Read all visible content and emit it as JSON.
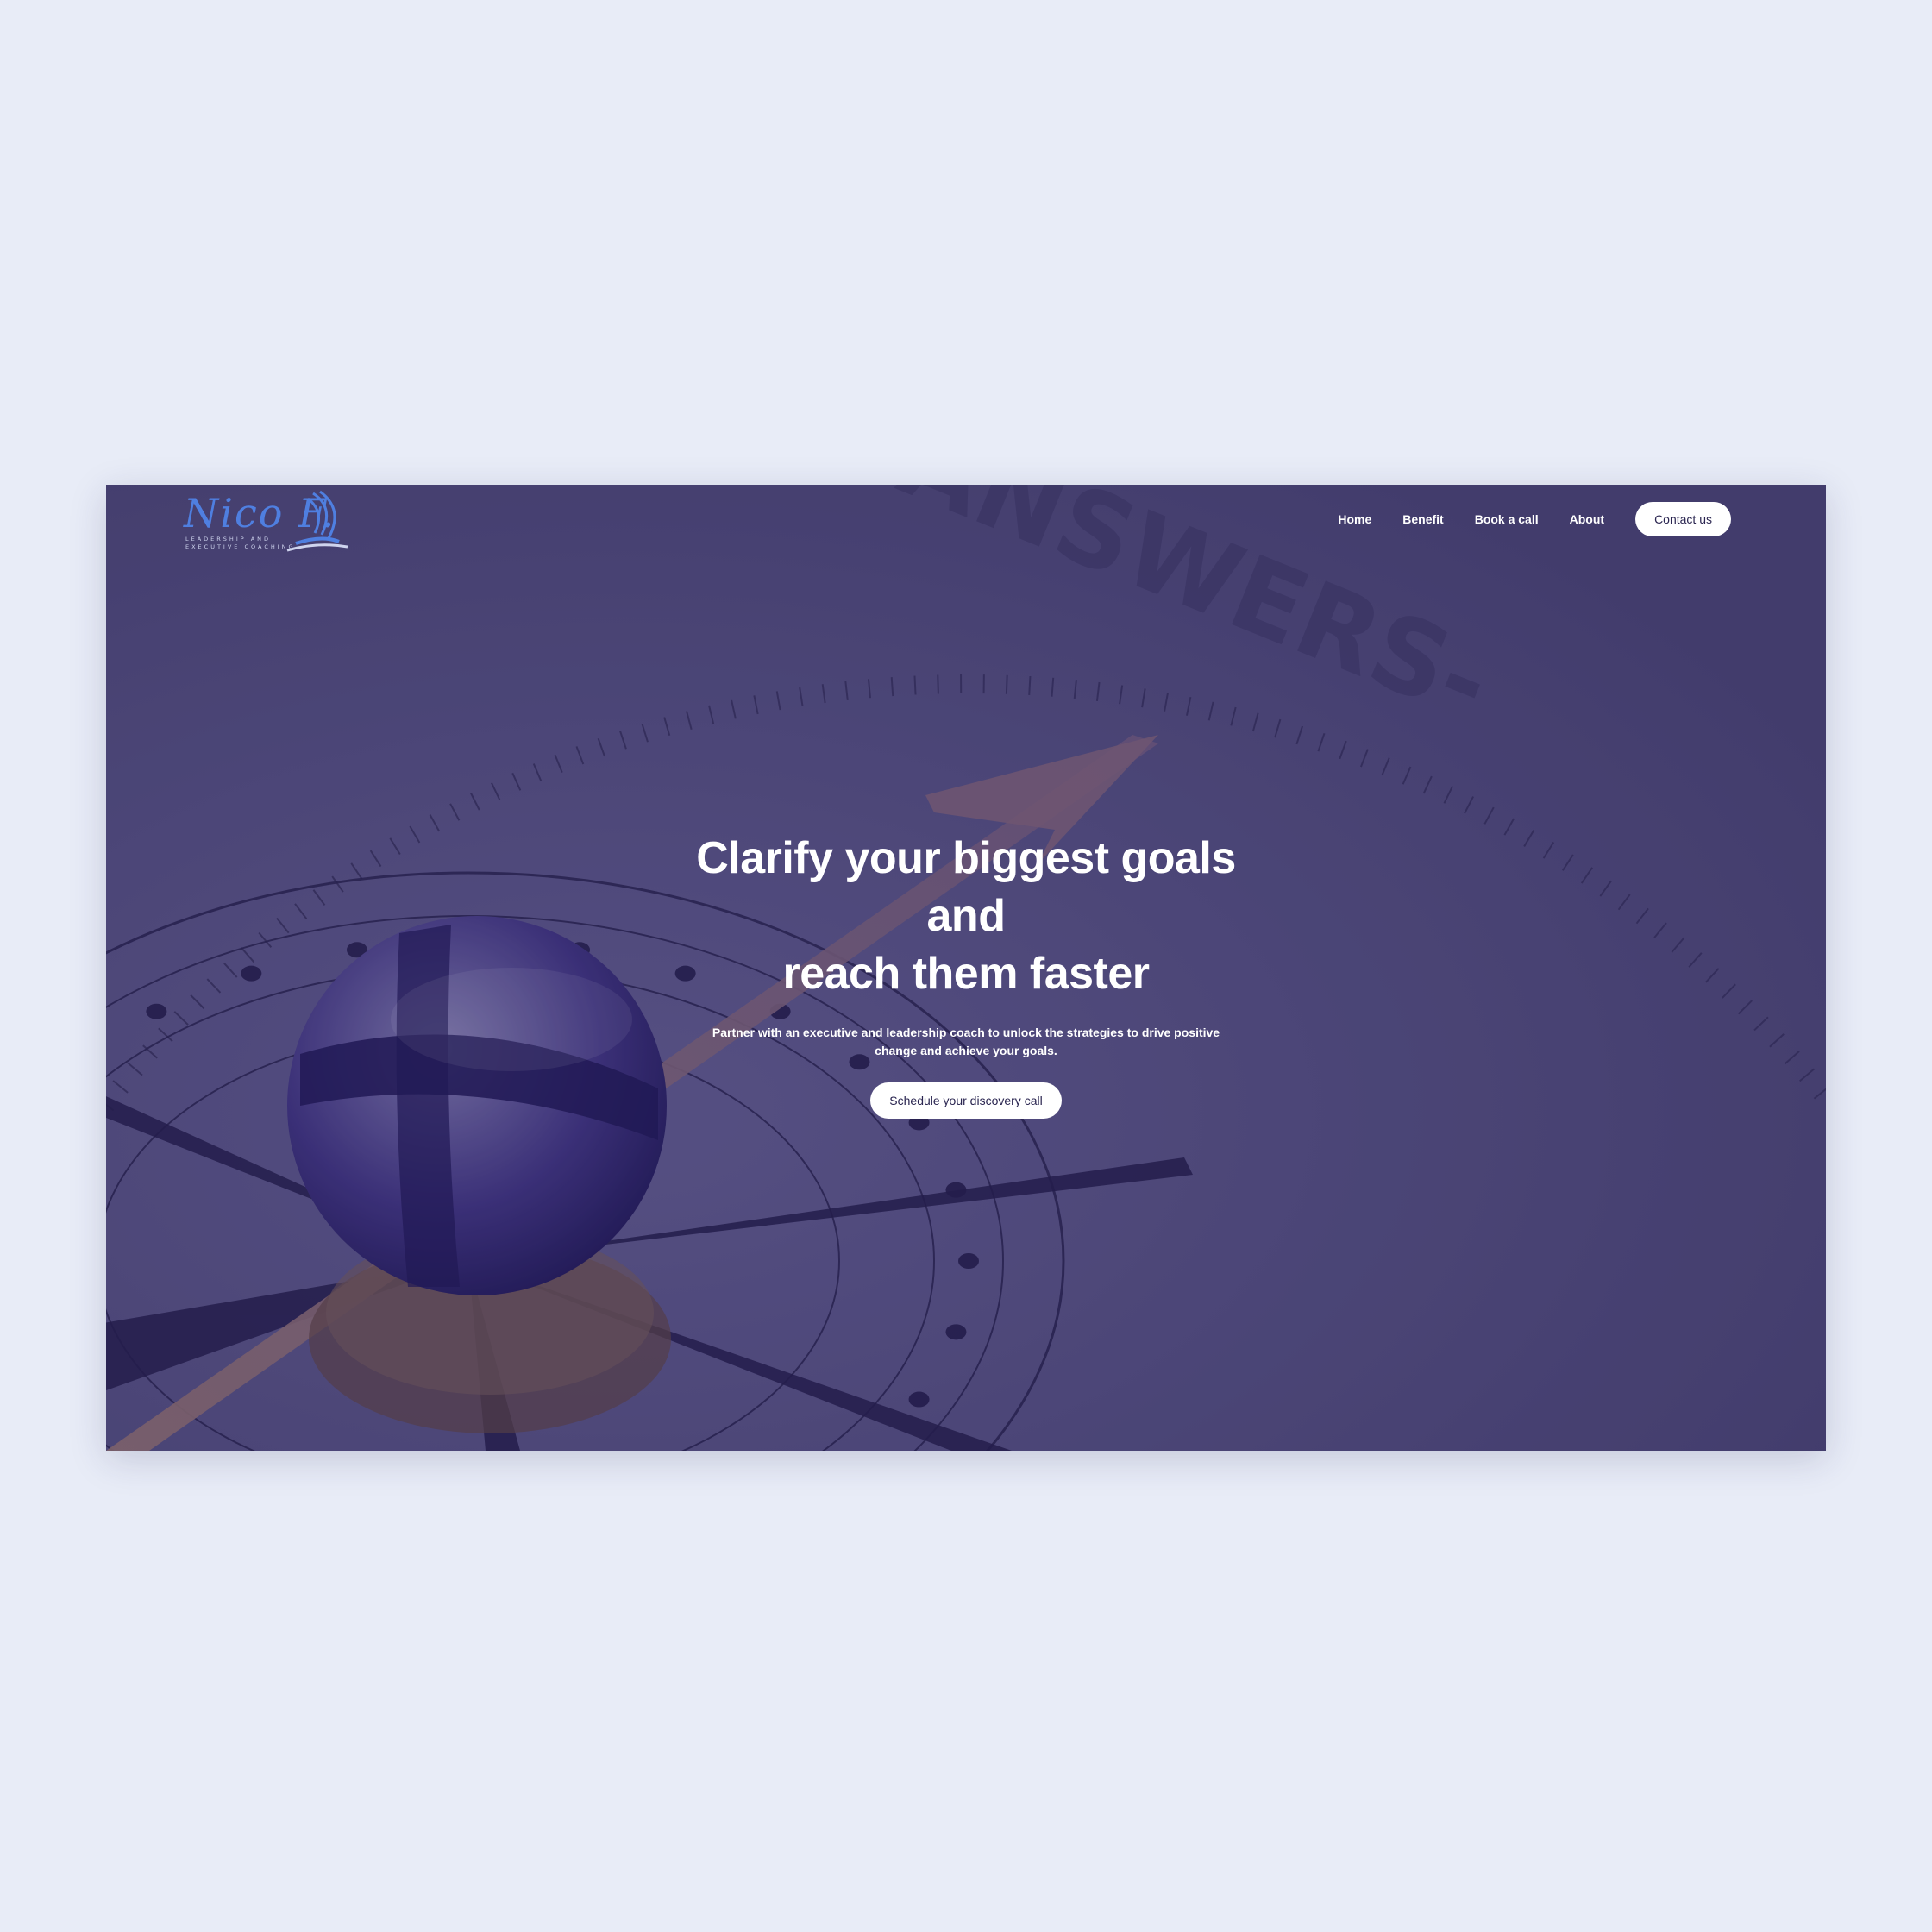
{
  "logo": {
    "script": "Nico F.",
    "subtitle_line1": "Leadership and",
    "subtitle_line2": "Executive Coaching"
  },
  "nav": {
    "items": [
      {
        "label": "Home"
      },
      {
        "label": "Benefit"
      },
      {
        "label": "Book a call"
      },
      {
        "label": "About"
      }
    ],
    "contact_label": "Contact us"
  },
  "background": {
    "compass_text": "-ANSWERS-"
  },
  "hero": {
    "title_line1": "Clarify your biggest goals",
    "title_line2": "and",
    "title_line3": "reach them faster",
    "subtitle": "Partner with an executive and leadership coach to unlock the strategies to drive positive change and achieve your goals.",
    "cta_label": "Schedule your discovery call"
  },
  "colors": {
    "page_bg": "#e8ecf7",
    "hero_bg": "#4a4470",
    "logo_blue": "#4f7fe0",
    "button_bg": "#ffffff",
    "button_text": "#2a2550"
  }
}
